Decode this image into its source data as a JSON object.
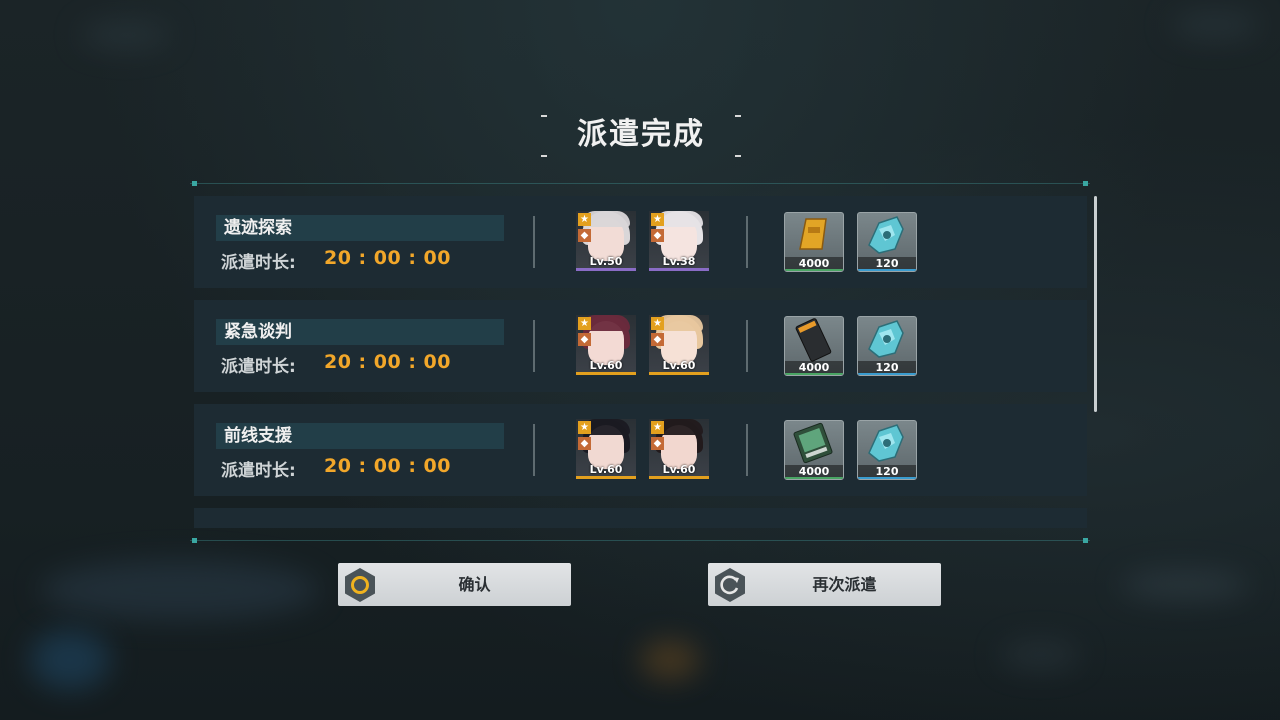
{
  "dialog": {
    "title": "派遣完成"
  },
  "missions": [
    {
      "name": "遗迹探索",
      "duration_label": "派遣时长:",
      "duration": "20 : 00 : 00",
      "characters": [
        {
          "level": "Lv.50",
          "rarity_color": "#8a6cc6",
          "hair": "#d9d6d8",
          "face": "#f2dcd6"
        },
        {
          "level": "Lv.38",
          "rarity_color": "#8a6cc6",
          "hair": "#e6e3e6",
          "face": "#f5e4e0"
        }
      ],
      "rewards": [
        {
          "icon": "gold-bar-icon",
          "quantity": "4000",
          "quality_color": "#4aa564"
        },
        {
          "icon": "core-module-icon",
          "quantity": "120",
          "quality_color": "#3a9ccf"
        }
      ]
    },
    {
      "name": "紧急谈判",
      "duration_label": "派遣时长:",
      "duration": "20 : 00 : 00",
      "characters": [
        {
          "level": "Lv.60",
          "rarity_color": "#e3a01e",
          "hair": "#6a2a3c",
          "face": "#f3dad4"
        },
        {
          "level": "Lv.60",
          "rarity_color": "#e3a01e",
          "hair": "#e8c79e",
          "face": "#f6e1d6"
        }
      ],
      "rewards": [
        {
          "icon": "ticket-icon",
          "quantity": "4000",
          "quality_color": "#4aa564"
        },
        {
          "icon": "core-module-icon",
          "quantity": "120",
          "quality_color": "#3a9ccf"
        }
      ]
    },
    {
      "name": "前线支援",
      "duration_label": "派遣时长:",
      "duration": "20 : 00 : 00",
      "characters": [
        {
          "level": "Lv.60",
          "rarity_color": "#e3a01e",
          "hair": "#1a1a22",
          "face": "#f1d9d2"
        },
        {
          "level": "Lv.60",
          "rarity_color": "#e3a01e",
          "hair": "#221a1c",
          "face": "#f2d7cf"
        }
      ],
      "rewards": [
        {
          "icon": "data-chip-icon",
          "quantity": "4000",
          "quality_color": "#4aa564"
        },
        {
          "icon": "core-module-icon",
          "quantity": "120",
          "quality_color": "#3a9ccf"
        }
      ]
    }
  ],
  "buttons": {
    "confirm": "确认",
    "redispatch": "再次派遣"
  }
}
